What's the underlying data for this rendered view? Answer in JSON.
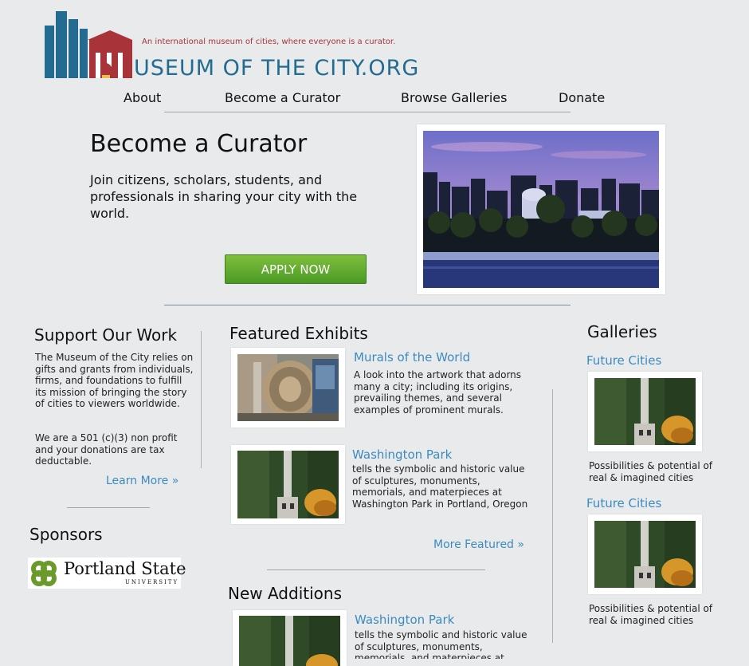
{
  "header": {
    "tagline": "An international museum of cities, where everyone is a curator.",
    "wordmark": "USEUM OF THE CITY.ORG"
  },
  "nav": [
    {
      "label": "About"
    },
    {
      "label": "Become a Curator"
    },
    {
      "label": "Browse Galleries"
    },
    {
      "label": "Donate"
    }
  ],
  "hero": {
    "title": "Become a Curator",
    "description": "Join citizens, scholars, students, and professionals in sharing your city with the world.",
    "button": "APPLY NOW"
  },
  "support": {
    "title": "Support Our Work",
    "para1": "The Museum of the City relies on gifts and grants from individuals, firms, and foundations to fulfill its mission of bringing the story of cities to viewers worldwide.",
    "para2": "We are a 501 (c)(3) non profit and your donations are tax deductable.",
    "link": "Learn More »"
  },
  "sponsors": {
    "title": "Sponsors",
    "logo_name": "Portland State",
    "logo_sub": "UNIVERSITY"
  },
  "featured": {
    "title": "Featured Exhibits",
    "items": [
      {
        "title": "Murals of the World",
        "text": "A look into the artwork that adorns many a city; including its origins, prevailing themes, and several examples of prominent murals."
      },
      {
        "title": "Washington Park",
        "text": "tells the symbolic and historic value of sculptures, monuments, memorials, and materpieces at Washington Park in Portland, Oregon"
      }
    ],
    "more": "More Featured »"
  },
  "new_additions": {
    "title": "New Additions",
    "items": [
      {
        "title": "Washington Park",
        "text": "tells the symbolic and historic value of sculptures, monuments, memorials, and materpieces at"
      }
    ]
  },
  "galleries": {
    "title": "Galleries",
    "items": [
      {
        "title": "Future Cities",
        "caption": "Possibilities & potential of real & imagined cities"
      },
      {
        "title": "Future Cities",
        "caption": "Possibilities & potential of real & imagined cities"
      }
    ]
  },
  "colors": {
    "background": "#e9eaec",
    "link": "#3b8bbf",
    "brand_blue": "#236b91",
    "brand_red": "#a8343a",
    "button_green": "#5fa62e"
  }
}
